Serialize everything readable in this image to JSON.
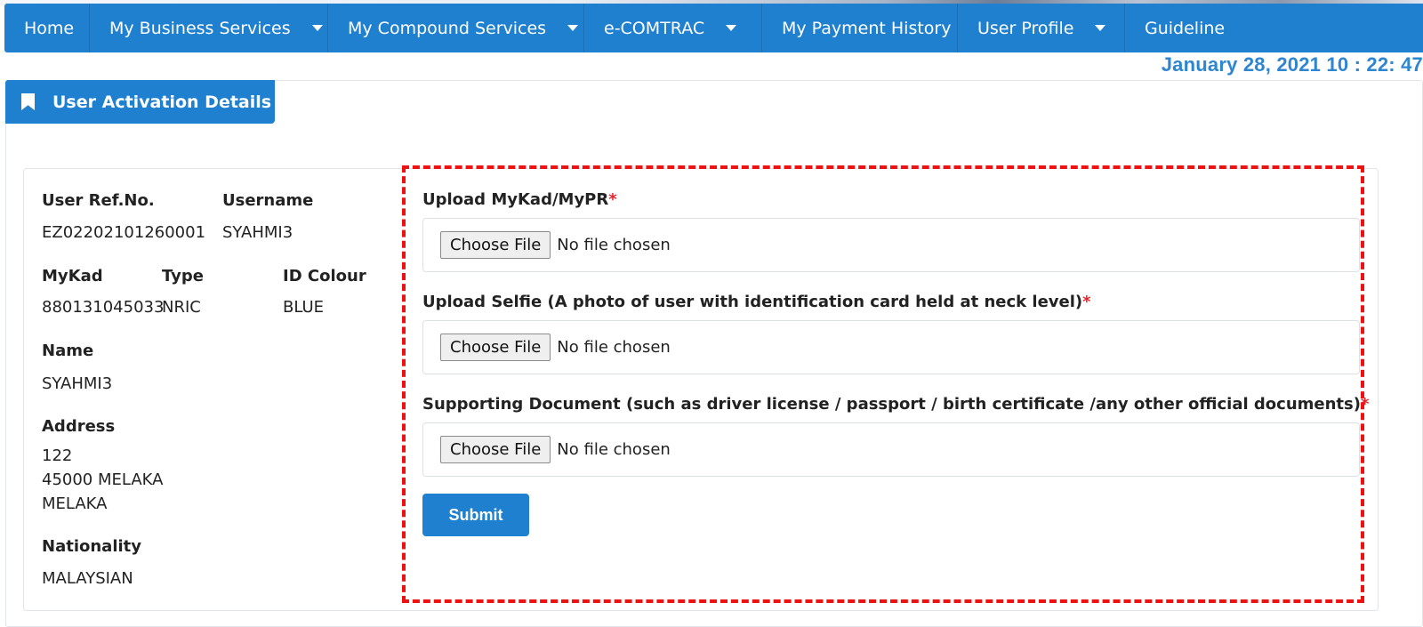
{
  "nav": {
    "items": [
      {
        "label": "Home",
        "dropdown": false
      },
      {
        "label": "My Business Services",
        "dropdown": true
      },
      {
        "label": "My Compound Services",
        "dropdown": true
      },
      {
        "label": "e-COMTRAC",
        "dropdown": true
      },
      {
        "label": "My Payment History",
        "dropdown": false
      },
      {
        "label": "User Profile",
        "dropdown": true
      },
      {
        "label": "Guideline",
        "dropdown": false
      }
    ]
  },
  "datetime": "January 28, 2021 10 : 22: 47",
  "panel": {
    "title": "User Activation Details",
    "icon": "bookmark-icon"
  },
  "user": {
    "ref_label": "User Ref.No.",
    "ref_value": "EZ02202101260001",
    "username_label": "Username",
    "username_value": "SYAHMI3",
    "mykad_label": "MyKad",
    "mykad_value": "880131045033",
    "type_label": "Type",
    "type_value": "NRIC",
    "idcolour_label": "ID Colour",
    "idcolour_value": "BLUE",
    "name_label": "Name",
    "name_value": "SYAHMI3",
    "address_label": "Address",
    "address_lines": [
      "122",
      "45000 MELAKA",
      "MELAKA"
    ],
    "nationality_label": "Nationality",
    "nationality_value": "MALAYSIAN"
  },
  "form": {
    "required_mark": "*",
    "choose_file_label": "Choose File",
    "no_file_text": "No file chosen",
    "fields": [
      {
        "label": "Upload MyKad/MyPR"
      },
      {
        "label": "Upload Selfie (A photo of user with identification card held at neck level)"
      },
      {
        "label": "Supporting Document (such as driver license / passport / birth certificate /any other official documents)"
      }
    ],
    "submit_label": "Submit"
  },
  "colors": {
    "primary": "#1f80d0",
    "datetime": "#2e86d1",
    "required": "#e3242b",
    "highlight_border": "#ee1111"
  }
}
